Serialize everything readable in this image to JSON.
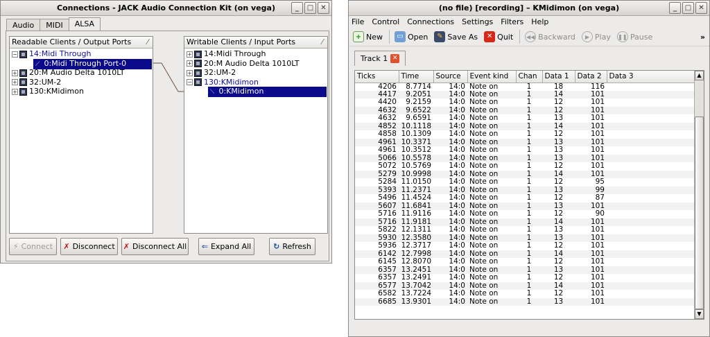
{
  "jack": {
    "title": "Connections - JACK Audio Connection Kit (on vega)",
    "tabs": [
      "Audio",
      "MIDI",
      "ALSA"
    ],
    "readable_header": "Readable Clients / Output Ports",
    "writable_header": "Writable Clients / Input Ports",
    "readable_clients": [
      {
        "label": "14:Midi Through",
        "expanded": true
      },
      {
        "label": "0:Midi Through Port-0",
        "port": true
      },
      {
        "label": "20:M Audio Delta 1010LT"
      },
      {
        "label": "32:UM-2"
      },
      {
        "label": "130:KMidimon"
      }
    ],
    "writable_clients": [
      {
        "label": "14:Midi Through"
      },
      {
        "label": "20:M Audio Delta 1010LT"
      },
      {
        "label": "32:UM-2"
      },
      {
        "label": "130:KMidimon",
        "expanded": true
      },
      {
        "label": "0:KMidimon",
        "port": true
      }
    ],
    "buttons": {
      "connect": "Connect",
      "disconnect": "Disconnect",
      "disconnect_all": "Disconnect All",
      "expand_all": "Expand All",
      "refresh": "Refresh"
    }
  },
  "kmidimon": {
    "title": "(no file) [recording] – KMidimon (on vega)",
    "menu": [
      "File",
      "Control",
      "Connections",
      "Settings",
      "Filters",
      "Help"
    ],
    "toolbar": {
      "new": "New",
      "open": "Open",
      "save_as": "Save As",
      "quit": "Quit",
      "backward": "Backward",
      "play": "Play",
      "pause": "Pause",
      "overflow": "»"
    },
    "track_tab": "Track 1",
    "columns": [
      "Ticks",
      "Time",
      "Source",
      "Event kind",
      "Chan",
      "Data 1",
      "Data 2",
      "Data 3"
    ],
    "rows": [
      [
        "4206",
        "8.7714",
        "14:0",
        "Note on",
        "1",
        "18",
        "116"
      ],
      [
        "4417",
        "9.2051",
        "14:0",
        "Note on",
        "1",
        "14",
        "101"
      ],
      [
        "4420",
        "9.2159",
        "14:0",
        "Note on",
        "1",
        "12",
        "101"
      ],
      [
        "4632",
        "9.6522",
        "14:0",
        "Note on",
        "1",
        "12",
        "101"
      ],
      [
        "4632",
        "9.6591",
        "14:0",
        "Note on",
        "1",
        "13",
        "101"
      ],
      [
        "4852",
        "10.1118",
        "14:0",
        "Note on",
        "1",
        "14",
        "101"
      ],
      [
        "4858",
        "10.1309",
        "14:0",
        "Note on",
        "1",
        "12",
        "101"
      ],
      [
        "4961",
        "10.3371",
        "14:0",
        "Note on",
        "1",
        "13",
        "101"
      ],
      [
        "4961",
        "10.3512",
        "14:0",
        "Note on",
        "1",
        "13",
        "101"
      ],
      [
        "5066",
        "10.5578",
        "14:0",
        "Note on",
        "1",
        "13",
        "101"
      ],
      [
        "5072",
        "10.5769",
        "14:0",
        "Note on",
        "1",
        "12",
        "101"
      ],
      [
        "5279",
        "10.9998",
        "14:0",
        "Note on",
        "1",
        "14",
        "101"
      ],
      [
        "5284",
        "11.0150",
        "14:0",
        "Note on",
        "1",
        "12",
        "95"
      ],
      [
        "5393",
        "11.2371",
        "14:0",
        "Note on",
        "1",
        "13",
        "99"
      ],
      [
        "5496",
        "11.4524",
        "14:0",
        "Note on",
        "1",
        "12",
        "87"
      ],
      [
        "5607",
        "11.6841",
        "14:0",
        "Note on",
        "1",
        "13",
        "101"
      ],
      [
        "5716",
        "11.9116",
        "14:0",
        "Note on",
        "1",
        "12",
        "90"
      ],
      [
        "5716",
        "11.9181",
        "14:0",
        "Note on",
        "1",
        "14",
        "101"
      ],
      [
        "5822",
        "12.1311",
        "14:0",
        "Note on",
        "1",
        "13",
        "101"
      ],
      [
        "5930",
        "12.3580",
        "14:0",
        "Note on",
        "1",
        "13",
        "101"
      ],
      [
        "5936",
        "12.3717",
        "14:0",
        "Note on",
        "1",
        "12",
        "101"
      ],
      [
        "6142",
        "12.7998",
        "14:0",
        "Note on",
        "1",
        "14",
        "101"
      ],
      [
        "6145",
        "12.8070",
        "14:0",
        "Note on",
        "1",
        "12",
        "101"
      ],
      [
        "6357",
        "13.2451",
        "14:0",
        "Note on",
        "1",
        "13",
        "101"
      ],
      [
        "6357",
        "13.2491",
        "14:0",
        "Note on",
        "1",
        "12",
        "101"
      ],
      [
        "6577",
        "13.7042",
        "14:0",
        "Note on",
        "1",
        "14",
        "101"
      ],
      [
        "6582",
        "13.7224",
        "14:0",
        "Note on",
        "1",
        "12",
        "101"
      ],
      [
        "6685",
        "13.9301",
        "14:0",
        "Note on",
        "1",
        "13",
        "101"
      ]
    ]
  }
}
